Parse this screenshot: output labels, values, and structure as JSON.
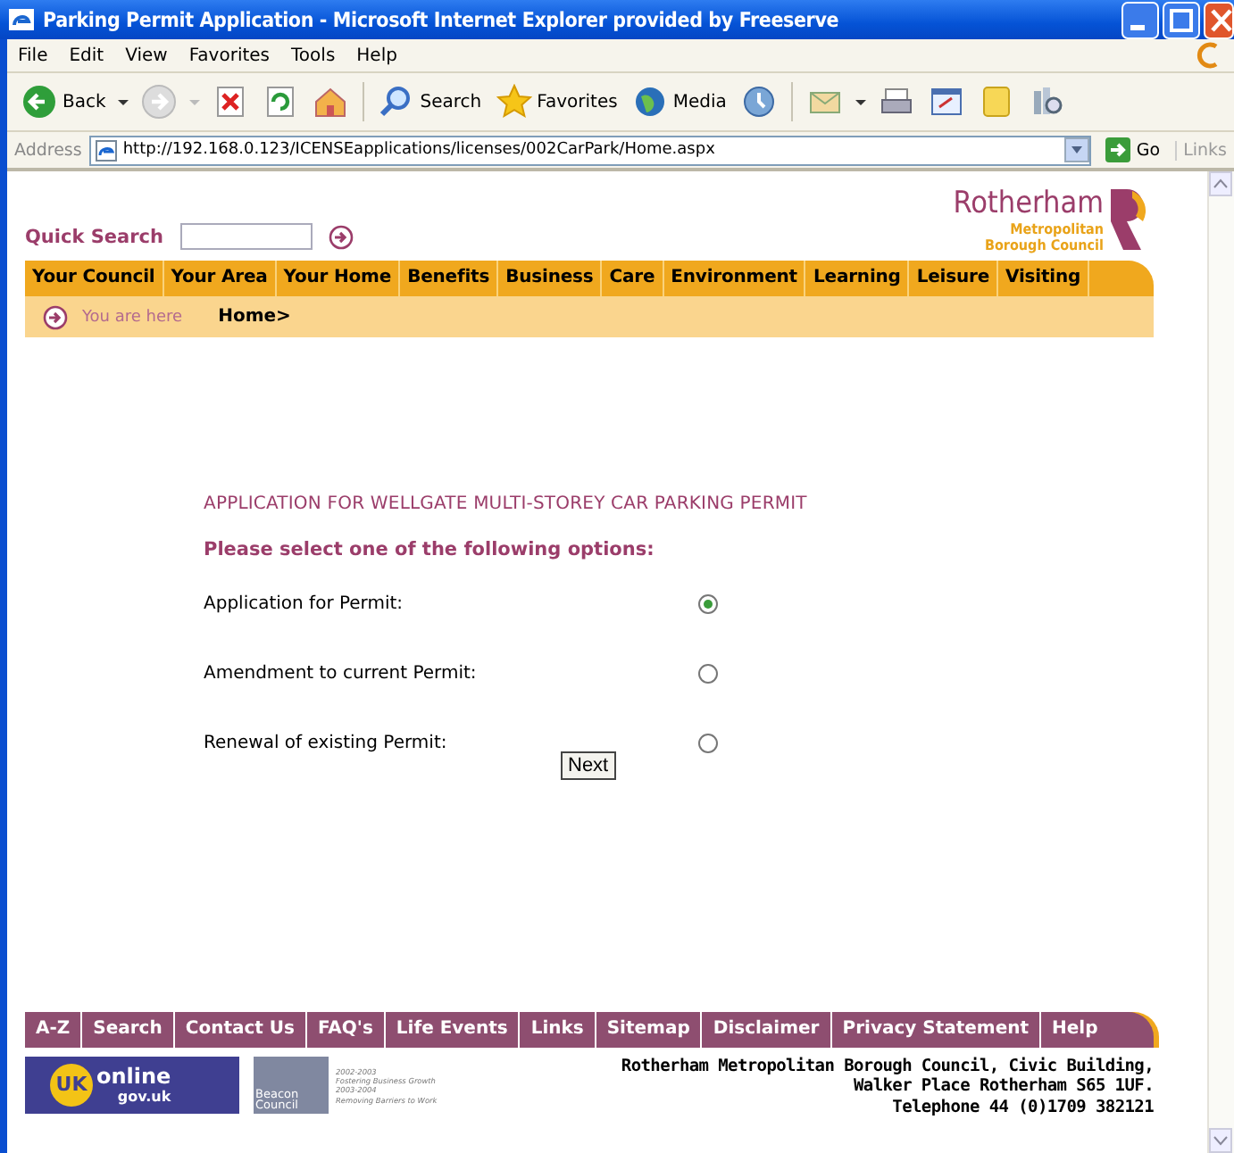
{
  "window": {
    "title": "Parking Permit Application - Microsoft Internet Explorer provided by Freeserve"
  },
  "menu": [
    "File",
    "Edit",
    "View",
    "Favorites",
    "Tools",
    "Help"
  ],
  "toolbar": [
    {
      "kind": "back",
      "label": "Back"
    },
    {
      "kind": "forward"
    },
    {
      "kind": "stop"
    },
    {
      "kind": "refresh"
    },
    {
      "kind": "home"
    },
    {
      "kind": "search",
      "label": "Search"
    },
    {
      "kind": "favorites",
      "label": "Favorites"
    },
    {
      "kind": "media",
      "label": "Media"
    },
    {
      "kind": "history"
    },
    {
      "kind": "mail"
    },
    {
      "kind": "print"
    },
    {
      "kind": "edit"
    },
    {
      "kind": "note"
    },
    {
      "kind": "research"
    }
  ],
  "address": {
    "label": "Address",
    "value": "http://192.168.0.123/ICENSEapplications/licenses/002CarPark/Home.aspx",
    "go": "Go",
    "links": "Links"
  },
  "site": {
    "quick_search": "Quick Search",
    "logo": {
      "name": "Rotherham",
      "sub1": "Metropolitan",
      "sub2": "Borough Council"
    },
    "nav": [
      "Your Council",
      "Your Area",
      "Your Home",
      "Benefits",
      "Business",
      "Care",
      "Environment",
      "Learning",
      "Leisure",
      "Visiting"
    ],
    "breadcrumb": {
      "label": "You are here",
      "path": "Home>"
    }
  },
  "form": {
    "title": "APPLICATION FOR WELLGATE MULTI-STOREY CAR PARKING PERMIT",
    "prompt": "Please select one of the following options:",
    "options": [
      {
        "label": "Application for Permit:",
        "selected": true
      },
      {
        "label": "Amendment to current Permit:",
        "selected": false
      },
      {
        "label": "Renewal of existing Permit:",
        "selected": false
      }
    ],
    "button": "Next"
  },
  "footer": {
    "links": [
      "A-Z",
      "Search",
      "Contact Us",
      "FAQ's",
      "Life Events",
      "Links",
      "Sitemap",
      "Disclaimer",
      "Privacy Statement",
      "Help"
    ],
    "ukonline": {
      "mark": "UK",
      "word": "online",
      "domain": "gov.uk"
    },
    "beacon": {
      "name": "Beacon Council",
      "years1": "2002-2003",
      "theme1": "Fostering Business Growth",
      "years2": "2003-2004",
      "theme2": "Removing Barriers to Work"
    },
    "address": [
      "Rotherham Metropolitan Borough Council, Civic Building,",
      "Walker Place Rotherham S65 1UF.",
      "Telephone 44 (0)1709 382121"
    ]
  }
}
